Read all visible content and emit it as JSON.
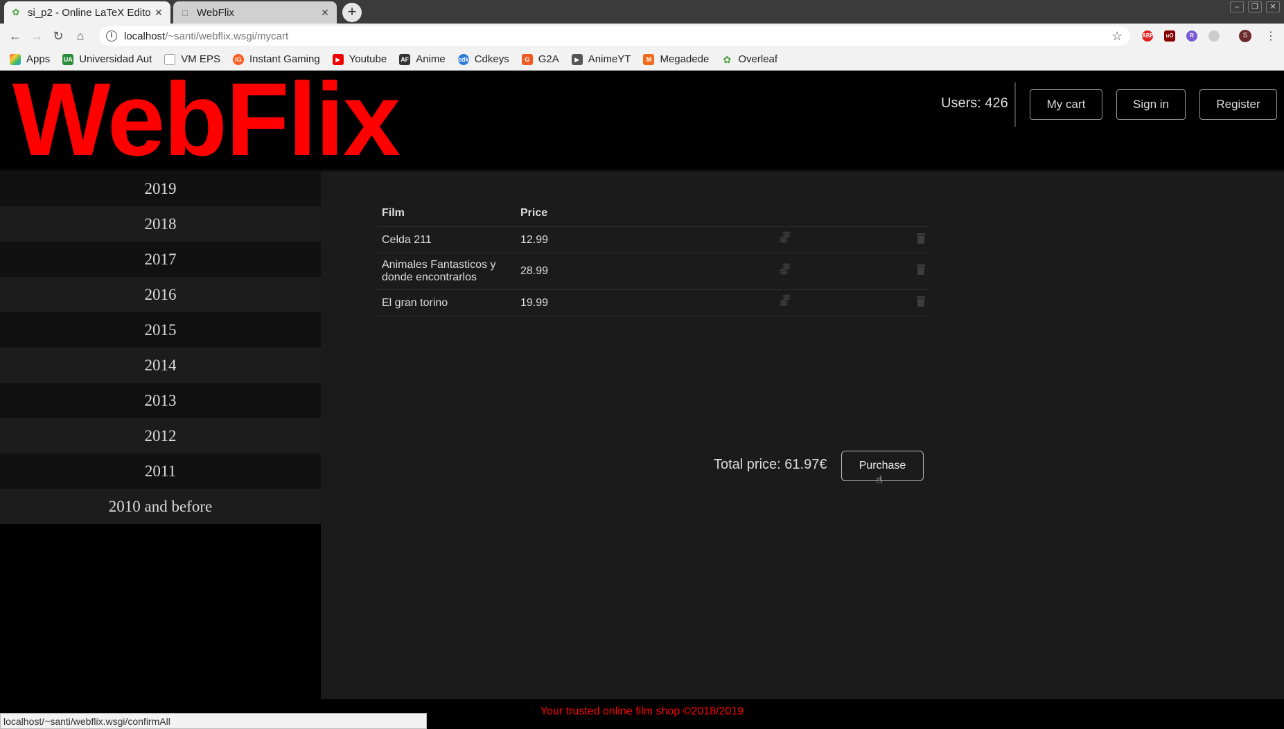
{
  "browser": {
    "tabs": [
      {
        "label": "si_p2 - Online LaTeX Edito",
        "icon": "overleaf-icon"
      },
      {
        "label": "WebFlix",
        "icon": "document-icon"
      }
    ],
    "url_host": "localhost",
    "url_path": "/~santi/webflix.wsgi/mycart",
    "profile_initial": "S",
    "bookmarks": [
      {
        "label": "Apps",
        "icon": "apps-grid-icon",
        "color": "#e44"
      },
      {
        "label": "Universidad Aut",
        "icon": "university-icon",
        "color": "#2a8c3a"
      },
      {
        "label": "VM EPS",
        "icon": "document-icon",
        "color": "#999"
      },
      {
        "label": "Instant Gaming",
        "icon": "instant-gaming-icon",
        "color": "#ff5a1f"
      },
      {
        "label": "Youtube",
        "icon": "youtube-icon",
        "color": "#e00"
      },
      {
        "label": "Anime",
        "icon": "animeflv-icon",
        "color": "#333"
      },
      {
        "label": "Cdkeys",
        "icon": "cdkeys-icon",
        "color": "#2b7ad6"
      },
      {
        "label": "G2A",
        "icon": "g2a-icon",
        "color": "#f05a22"
      },
      {
        "label": "AnimeYT",
        "icon": "animeyt-icon",
        "color": "#555"
      },
      {
        "label": "Megadede",
        "icon": "megadede-icon",
        "color": "#f26a1b"
      },
      {
        "label": "Overleaf",
        "icon": "overleaf-icon",
        "color": "#47a141"
      }
    ],
    "status_url": "localhost/~santi/webflix.wsgi/confirmAll"
  },
  "header": {
    "logo": "WebFlix",
    "users": "Users: 426",
    "my_cart": "My cart",
    "sign_in": "Sign in",
    "register": "Register"
  },
  "sidebar": {
    "years": [
      "2019",
      "2018",
      "2017",
      "2016",
      "2015",
      "2014",
      "2013",
      "2012",
      "2011",
      "2010 and before"
    ]
  },
  "cart": {
    "headers": {
      "film": "Film",
      "price": "Price"
    },
    "rows": [
      {
        "film": "Celda 211",
        "price": "12.99"
      },
      {
        "film": "Animales Fantasticos y donde encontrarlos",
        "price": "28.99"
      },
      {
        "film": "El gran torino",
        "price": "19.99"
      }
    ],
    "total": "Total price: 61.97€",
    "purchase": "Purchase"
  },
  "footer": {
    "text": "Your trusted online film shop ©2018/2019"
  },
  "colors": {
    "brand": "#ff0000",
    "page_bg": "#000000",
    "content_bg": "#1b1b1b"
  }
}
